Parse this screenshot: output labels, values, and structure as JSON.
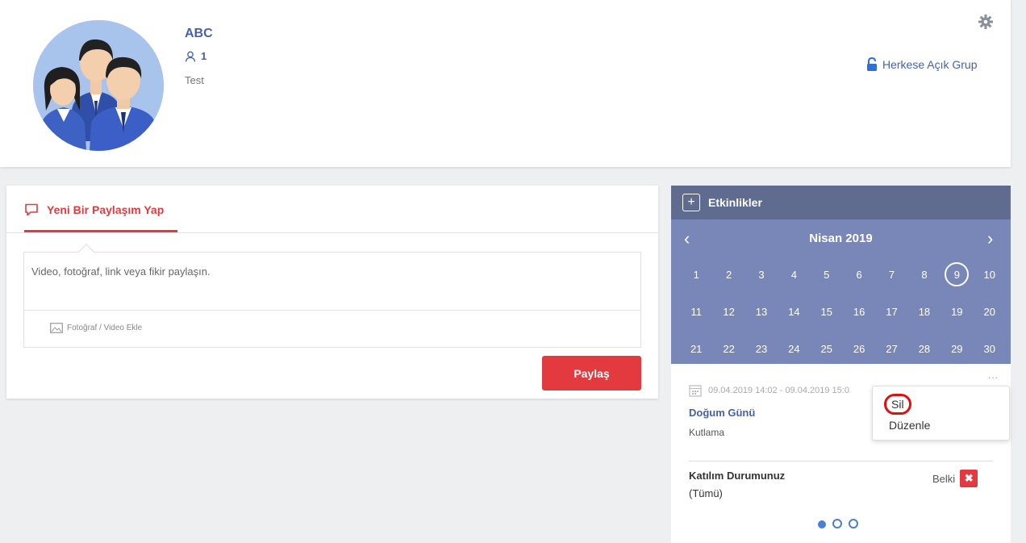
{
  "group": {
    "name": "ABC",
    "member_count": "1",
    "description": "Test",
    "privacy": "Herkese Açık Grup"
  },
  "post": {
    "tab_label": "Yeni Bir Paylaşım Yap",
    "placeholder": "Video, fotoğraf, link veya fikir paylaşın.",
    "media_label": "Fotoğraf / Video Ekle",
    "share_label": "Paylaş"
  },
  "events": {
    "title": "Etkinlikler",
    "month": "Nisan 2019",
    "days": [
      "1",
      "2",
      "3",
      "4",
      "5",
      "6",
      "7",
      "8",
      "9",
      "10",
      "11",
      "12",
      "13",
      "14",
      "15",
      "16",
      "17",
      "18",
      "19",
      "20",
      "21",
      "22",
      "23",
      "24",
      "25",
      "26",
      "27",
      "28",
      "29",
      "30"
    ],
    "selected_day": "9",
    "more": "...",
    "event": {
      "time": "09.04.2019 14:02 - 09.04.2019 15:0",
      "title": "Doğum Günü",
      "description": "Kutlama"
    },
    "participation": {
      "label": "Katılım Durumunuz",
      "filter": "(Tümü)",
      "status": "Belki"
    },
    "context_menu": {
      "delete": "Sil",
      "edit": "Düzenle"
    }
  },
  "colors": {
    "accent_red": "#e23a3e",
    "brand_blue": "#4660b0",
    "calendar_bg": "#7986b8",
    "header_bg": "#5f6b8f"
  }
}
